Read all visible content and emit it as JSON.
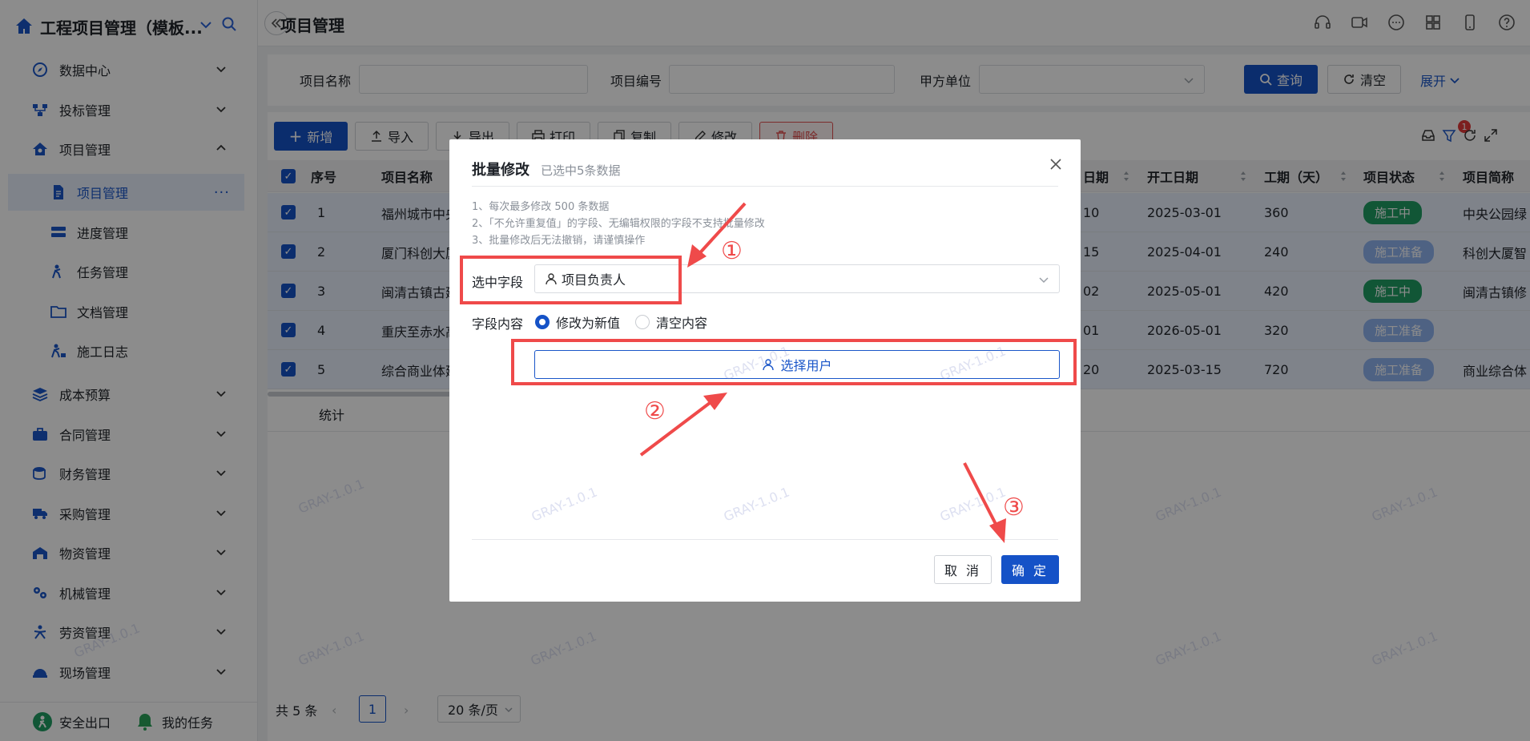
{
  "app": {
    "title": "工程项目管理（模板...",
    "page_title": "项目管理"
  },
  "sidebar": {
    "items": [
      {
        "label": "数据中心",
        "icon": "compass-icon"
      },
      {
        "label": "投标管理",
        "icon": "flow-icon"
      },
      {
        "label": "项目管理",
        "icon": "home-gear-icon"
      },
      {
        "label": "成本预算",
        "icon": "stack-icon"
      },
      {
        "label": "合同管理",
        "icon": "briefcase-icon"
      },
      {
        "label": "财务管理",
        "icon": "coins-icon"
      },
      {
        "label": "采购管理",
        "icon": "truck-icon"
      },
      {
        "label": "物资管理",
        "icon": "warehouse-icon"
      },
      {
        "label": "机械管理",
        "icon": "gears-icon"
      },
      {
        "label": "劳资管理",
        "icon": "worker-icon"
      },
      {
        "label": "现场管理",
        "icon": "helmet-icon"
      }
    ],
    "subitems": [
      {
        "label": "项目管理",
        "icon": "document-icon"
      },
      {
        "label": "进度管理",
        "icon": "progress-icon"
      },
      {
        "label": "任务管理",
        "icon": "task-icon"
      },
      {
        "label": "文档管理",
        "icon": "folder-icon"
      },
      {
        "label": "施工日志",
        "icon": "log-icon"
      }
    ],
    "bottom": {
      "exit": "安全出口",
      "tasks": "我的任务"
    }
  },
  "filter": {
    "name_label": "项目名称",
    "code_label": "项目编号",
    "party_label": "甲方单位",
    "query": "查询",
    "clear": "清空",
    "expand": "展开"
  },
  "toolbar": {
    "add": "新增",
    "import": "导入",
    "export": "导出",
    "print": "打印",
    "copy": "复制",
    "edit": "修改",
    "delete": "删除",
    "filter_badge": "1"
  },
  "table": {
    "headers": {
      "index": "序号",
      "name": "项目名称",
      "end_date": "日期",
      "start_date": "开工日期",
      "duration": "工期（天）",
      "status": "项目状态",
      "short": "项目简称"
    },
    "rows": [
      {
        "index": "1",
        "name": "福州城市中央",
        "end": "10",
        "start": "2025-03-01",
        "duration": "360",
        "status": "施工中",
        "short": "中央公园绿"
      },
      {
        "index": "2",
        "name": "厦门科创大厦",
        "end": "15",
        "start": "2025-04-01",
        "duration": "240",
        "status": "施工准备",
        "short": "科创大厦智"
      },
      {
        "index": "3",
        "name": "闽清古镇古建",
        "end": "02",
        "start": "2025-05-01",
        "duration": "420",
        "status": "施工中",
        "short": "闽清古镇修"
      },
      {
        "index": "4",
        "name": "重庆至赤水高",
        "end": "01",
        "start": "2026-05-01",
        "duration": "320",
        "status": "施工准备",
        "short": ""
      },
      {
        "index": "5",
        "name": "综合商业体建",
        "end": "20",
        "start": "2025-03-15",
        "duration": "720",
        "status": "施工准备",
        "short": "商业综合体"
      }
    ],
    "summary_label": "统计"
  },
  "pager": {
    "total": "共 5 条",
    "page": "1",
    "per_page": "20 条/页"
  },
  "modal": {
    "title": "批量修改",
    "subtitle": "已选中5条数据",
    "notes": [
      "1、每次最多修改 500 条数据",
      "2、「不允许重复值」的字段、无编辑权限的字段不支持批量修改",
      "3、批量修改后无法撤销，请谨慎操作"
    ],
    "field_label": "选中字段",
    "field_value": "项目负责人",
    "content_label": "字段内容",
    "radio_new": "修改为新值",
    "radio_clear": "清空内容",
    "select_user": "选择用户",
    "cancel": "取 消",
    "ok": "确 定"
  },
  "annotations": {
    "one": "①",
    "two": "②",
    "three": "③"
  },
  "watermark": "GRAY-1.0.1",
  "colors": {
    "primary": "#1552c7",
    "annotation": "#ef4a4a",
    "success": "#1f9d63",
    "prep": "#8fb2ee"
  }
}
